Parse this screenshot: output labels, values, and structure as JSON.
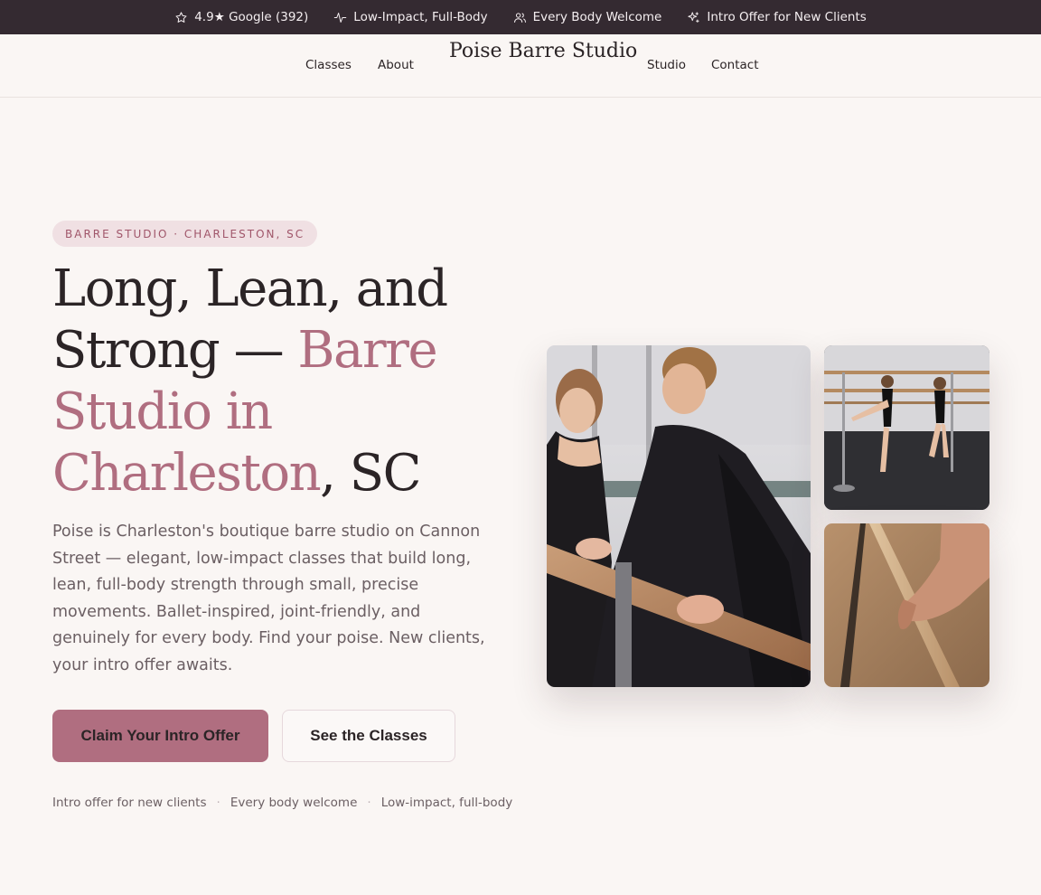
{
  "topbar": {
    "items": [
      {
        "icon": "star-icon",
        "text": "4.9★ Google (392)"
      },
      {
        "icon": "pulse-icon",
        "text": "Low-Impact, Full-Body"
      },
      {
        "icon": "users-icon",
        "text": "Every Body Welcome"
      },
      {
        "icon": "sparkle-icon",
        "text": "Intro Offer for New Clients"
      }
    ]
  },
  "nav": {
    "logo": "Poise Barre Studio",
    "links": [
      "Classes",
      "About",
      "Studio",
      "Contact"
    ]
  },
  "hero": {
    "badge": "BARRE STUDIO · CHARLESTON, SC",
    "headline_part1": "Long, Lean, and Strong — ",
    "headline_accent": "Barre Studio in Charleston",
    "headline_part2": ", SC",
    "lead": "Poise is Charleston's boutique barre studio on Cannon Street — elegant, low-impact classes that build long, lean, full-body strength through small, precise movements. Ballet-inspired, joint-friendly, and genuinely for every body. Find your poise. New clients, your intro offer awaits.",
    "primary_cta": "Claim Your Intro Offer",
    "secondary_cta": "See the Classes",
    "perks": [
      "Intro offer for new clients",
      "Every body welcome",
      "Low-impact, full-body"
    ]
  },
  "colors": {
    "accent": "#b06e80",
    "topbar_bg": "#342a31",
    "page_bg": "#faf6f4",
    "text": "#2b2426"
  }
}
